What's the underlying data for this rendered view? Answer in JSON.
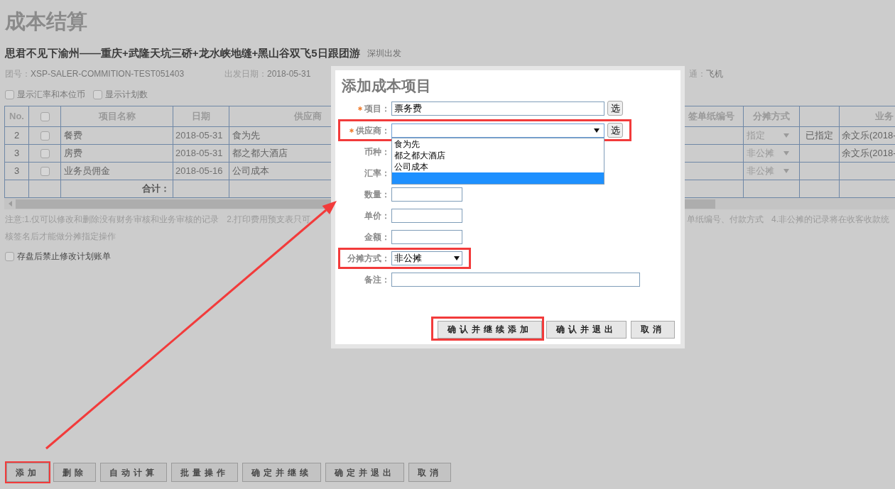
{
  "page": {
    "title": "成本结算"
  },
  "tour": {
    "name": "思君不见下渝州——重庆+武隆天坑三硚+龙水峡地缝+黑山谷双飞5日跟团游",
    "departure": "深圳出发"
  },
  "info": [
    {
      "label": "团号：",
      "value": "XSP-SALER-COMMITION-TEST051403"
    },
    {
      "label": "出发日期：",
      "value": "2018-05-31"
    },
    {
      "label": "通：",
      "value": "飞机"
    }
  ],
  "display_options": [
    {
      "label": "显示汇率和本位币",
      "checked": false
    },
    {
      "label": "显示计划数",
      "checked": false
    }
  ],
  "table": {
    "header": {
      "no": "No.",
      "checked": false,
      "item_name": "项目名称",
      "date": "日期",
      "supplier": "供应商",
      "receipt_no": "签单纸编号",
      "allocation": "分摊方式",
      "column_10": "业务"
    },
    "rows": [
      {
        "no": "2",
        "checked": false,
        "item_name": "餐费",
        "date": "2018-05-31",
        "supplier": "食为先",
        "allocation": "指定",
        "column_9": "已指定",
        "column_10": "余文乐(2018-"
      },
      {
        "no": "3",
        "checked": false,
        "item_name": "房费",
        "date": "2018-05-31",
        "supplier": "都之都大酒店",
        "allocation": "非公摊",
        "column_10": "余文乐(2018-"
      },
      {
        "no": "3",
        "checked": false,
        "item_name": "业务员佣金",
        "date": "2018-05-16",
        "supplier": "公司成本",
        "allocation": "非公摊"
      }
    ],
    "total_label": "合计："
  },
  "notes": {
    "line_1_left": [
      "注意:1.仅可以修改和删除没有财务审核和业务审核的记录",
      "2.打印费用预支表只可"
    ],
    "line_1_right": [
      "单纸编号、付款方式",
      "4.非公摊的记录将在收客收款统"
    ],
    "line_2": "核签名后才能做分摊指定操作"
  },
  "lock_option": {
    "label": "存盘后禁止修改计划账单",
    "checked": false
  },
  "toolbar": [
    {
      "label": "添加",
      "annotated": true
    },
    {
      "label": "删除",
      "annotated": false
    },
    {
      "label": "自动计算",
      "annotated": false
    },
    {
      "label": "批量操作",
      "annotated": false
    },
    {
      "label": "确定并继续",
      "annotated": false
    },
    {
      "label": "确定并退出",
      "annotated": false
    },
    {
      "label": "取消",
      "annotated": false
    }
  ],
  "dialog": {
    "title": "添加成本项目",
    "fields": [
      {
        "kind": "text",
        "label": "项目：",
        "required": true,
        "value": "票务费",
        "picker": "选",
        "annotated": false
      },
      {
        "kind": "select",
        "label": "供应商：",
        "required": true,
        "picker": "选",
        "annotated": true,
        "expanded": true,
        "options": [
          {
            "label": "食为先",
            "selected": false
          },
          {
            "label": "都之都大酒店",
            "selected": false
          },
          {
            "label": "公司成本",
            "selected": false
          },
          {
            "selected": true
          }
        ]
      },
      {
        "kind": "covered",
        "label": "币种：",
        "required": false,
        "annotated": false
      },
      {
        "kind": "covered",
        "label": "汇率：",
        "required": false,
        "annotated": false
      },
      {
        "kind": "short_text",
        "label": "数量：",
        "required": false,
        "annotated": false
      },
      {
        "kind": "short_text",
        "label": "单价：",
        "required": false,
        "annotated": false
      },
      {
        "kind": "short_text",
        "label": "金额：",
        "required": false,
        "annotated": false
      },
      {
        "kind": "short_select",
        "label": "分摊方式：",
        "required": false,
        "value": "非公摊",
        "annotated": true
      },
      {
        "kind": "long_text",
        "label": "备注：",
        "required": false,
        "annotated": false
      }
    ],
    "buttons": [
      {
        "label": "确认并继续添加",
        "annotated": true
      },
      {
        "label": "确认并退出",
        "annotated": false
      },
      {
        "label": "取消",
        "annotated": false
      }
    ]
  }
}
